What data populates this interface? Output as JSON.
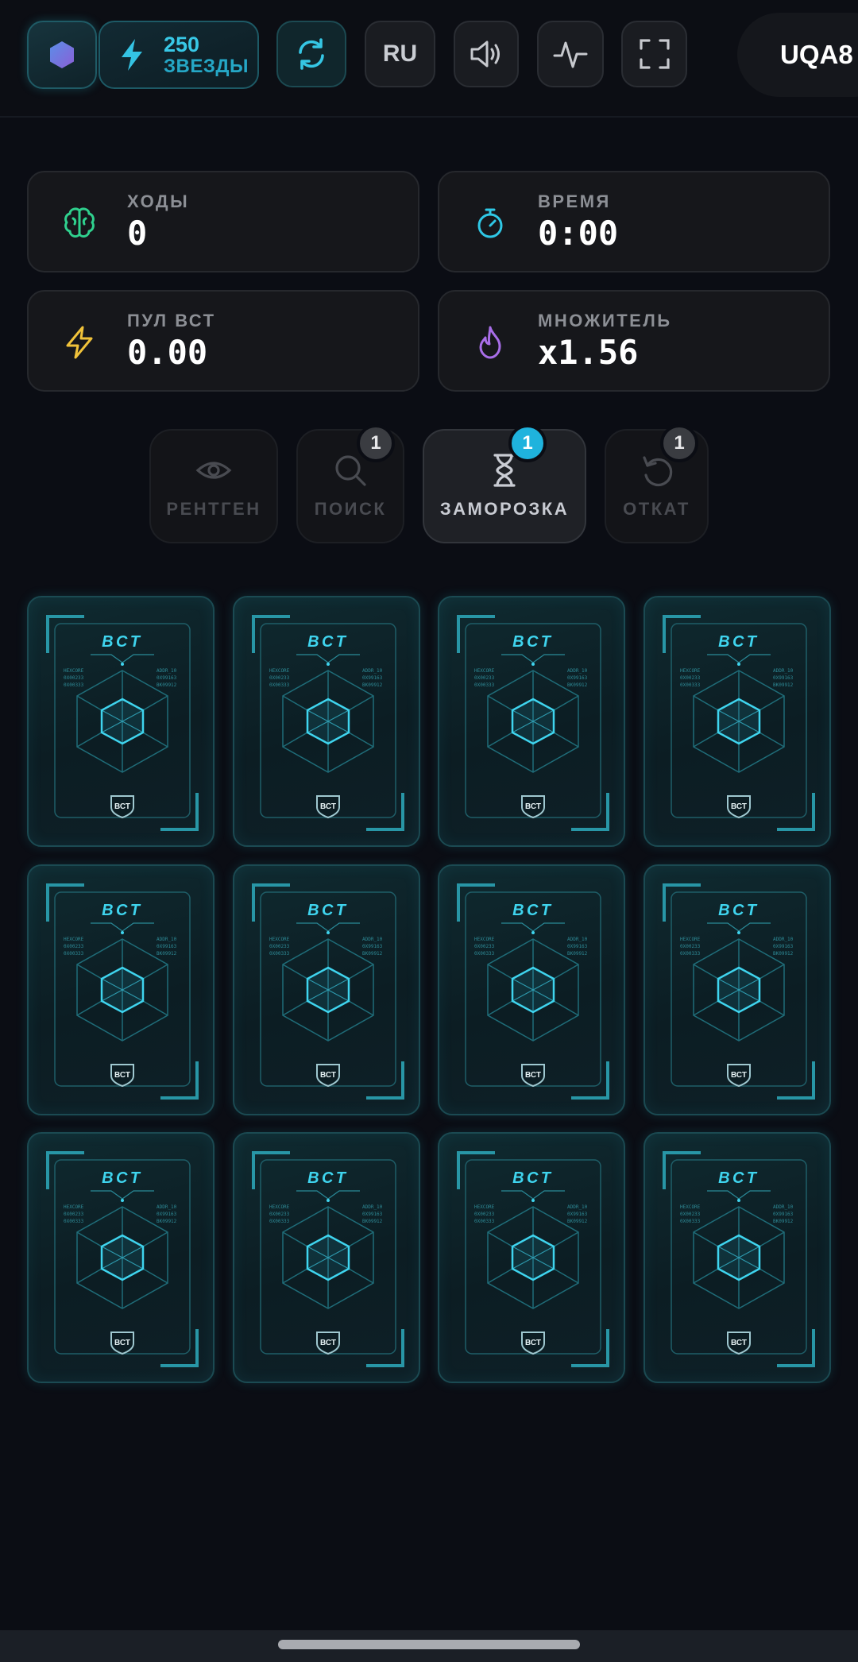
{
  "header": {
    "stars_amount": "250",
    "stars_label": "ЗВЕЗДЫ",
    "language": "RU",
    "user_id": "UQA8"
  },
  "stats": [
    {
      "label": "ХОДЫ",
      "value": "0",
      "icon": "brain-icon",
      "color": "#2fd18e"
    },
    {
      "label": "ВРЕМЯ",
      "value": "0:00",
      "icon": "stopwatch-icon",
      "color": "#2fc8e6"
    },
    {
      "label": "ПУЛ ВСТ",
      "value": "0.00",
      "icon": "lightning-icon",
      "color": "#f0c23a"
    },
    {
      "label": "МНОЖИТЕЛЬ",
      "value": "x1.56",
      "icon": "flame-icon",
      "color": "#a86ee8"
    }
  ],
  "powerups": [
    {
      "label": "РЕНТГЕН",
      "icon": "eye-icon",
      "badge": null,
      "active": false
    },
    {
      "label": "ПОИСК",
      "icon": "magnifier-icon",
      "badge": "1",
      "active": false
    },
    {
      "label": "ЗАМОРОЗКА",
      "icon": "hourglass-icon",
      "badge": "1",
      "active": true
    },
    {
      "label": "ОТКАТ",
      "icon": "undo-icon",
      "badge": "1",
      "active": false
    }
  ],
  "card_back": {
    "title": "ВСТ",
    "shield_text": "ВСТ",
    "left_code": [
      "HEXCORE",
      "0X00233",
      "0X00333"
    ],
    "right_code": [
      "ADDR_10",
      "0X99163",
      "BK09912"
    ]
  },
  "cards_count": 12,
  "colors": {
    "accent": "#2fc8e6",
    "background": "#0b0d14"
  }
}
